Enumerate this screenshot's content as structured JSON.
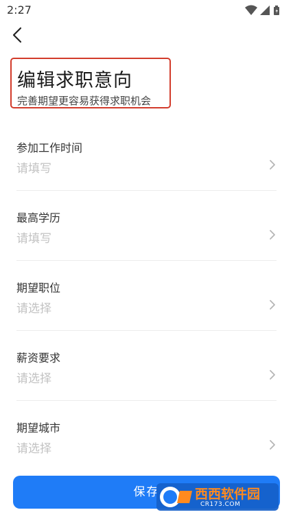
{
  "status_bar": {
    "time": "2:27"
  },
  "header": {
    "title": "编辑求职意向",
    "subtitle": "完善期望更容易获得求职机会",
    "highlight_color": "#d23a2a"
  },
  "form": {
    "rows": [
      {
        "label": "参加工作时间",
        "placeholder": "请填写"
      },
      {
        "label": "最高学历",
        "placeholder": "请填写"
      },
      {
        "label": "期望职位",
        "placeholder": "请选择"
      },
      {
        "label": "薪资要求",
        "placeholder": "请选择"
      },
      {
        "label": "期望城市",
        "placeholder": "请选择"
      }
    ]
  },
  "footer": {
    "save_label": "保存",
    "accent_color": "#1f7cf7"
  },
  "watermark": {
    "brand": "西西软件园",
    "url": "CR173.COM"
  },
  "icons": {
    "back": "back-arrow-icon",
    "row_chevron": "chevron-right-icon",
    "wifi": "wifi-icon",
    "signal": "signal-icon",
    "battery": "battery-icon"
  }
}
